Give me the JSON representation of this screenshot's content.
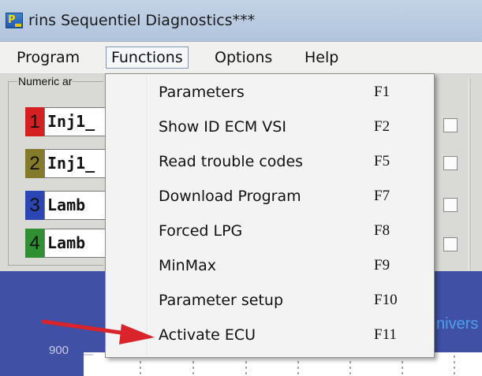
{
  "window": {
    "title": "rins Sequentiel Diagnostics***",
    "icon_text": "P"
  },
  "menubar": {
    "items": [
      {
        "label": "Program"
      },
      {
        "label": "Functions"
      },
      {
        "label": "Options"
      },
      {
        "label": "Help"
      }
    ]
  },
  "panel": {
    "group_label": "Numeric ar",
    "channels": [
      {
        "number": "1",
        "value": "Inj1_",
        "color": "#d42020"
      },
      {
        "number": "2",
        "value": "Inj1_",
        "color": "#837a2a"
      },
      {
        "number": "3",
        "value": "Lamb",
        "color": "#2c45b4"
      },
      {
        "number": "4",
        "value": "Lamb",
        "color": "#2f8f32"
      }
    ]
  },
  "functions_menu": {
    "items": [
      {
        "label": "Parameters",
        "shortcut": "F1"
      },
      {
        "label": "Show ID ECM VSI",
        "shortcut": "F2"
      },
      {
        "label": "Read trouble codes",
        "shortcut": "F5"
      },
      {
        "label": "Download Program",
        "shortcut": "F7"
      },
      {
        "label": "Forced LPG",
        "shortcut": "F8"
      },
      {
        "label": "MinMax",
        "shortcut": "F9"
      },
      {
        "label": "Parameter setup",
        "shortcut": "F10"
      },
      {
        "label": "Activate ECU",
        "shortcut": "F11"
      }
    ]
  },
  "chart": {
    "tick_label": "900",
    "edge_text": "nivers"
  },
  "colors": {
    "annotation_arrow": "#d8242a",
    "chart_background": "#3f50a5",
    "menu_highlight_border": "#7e97b6"
  }
}
